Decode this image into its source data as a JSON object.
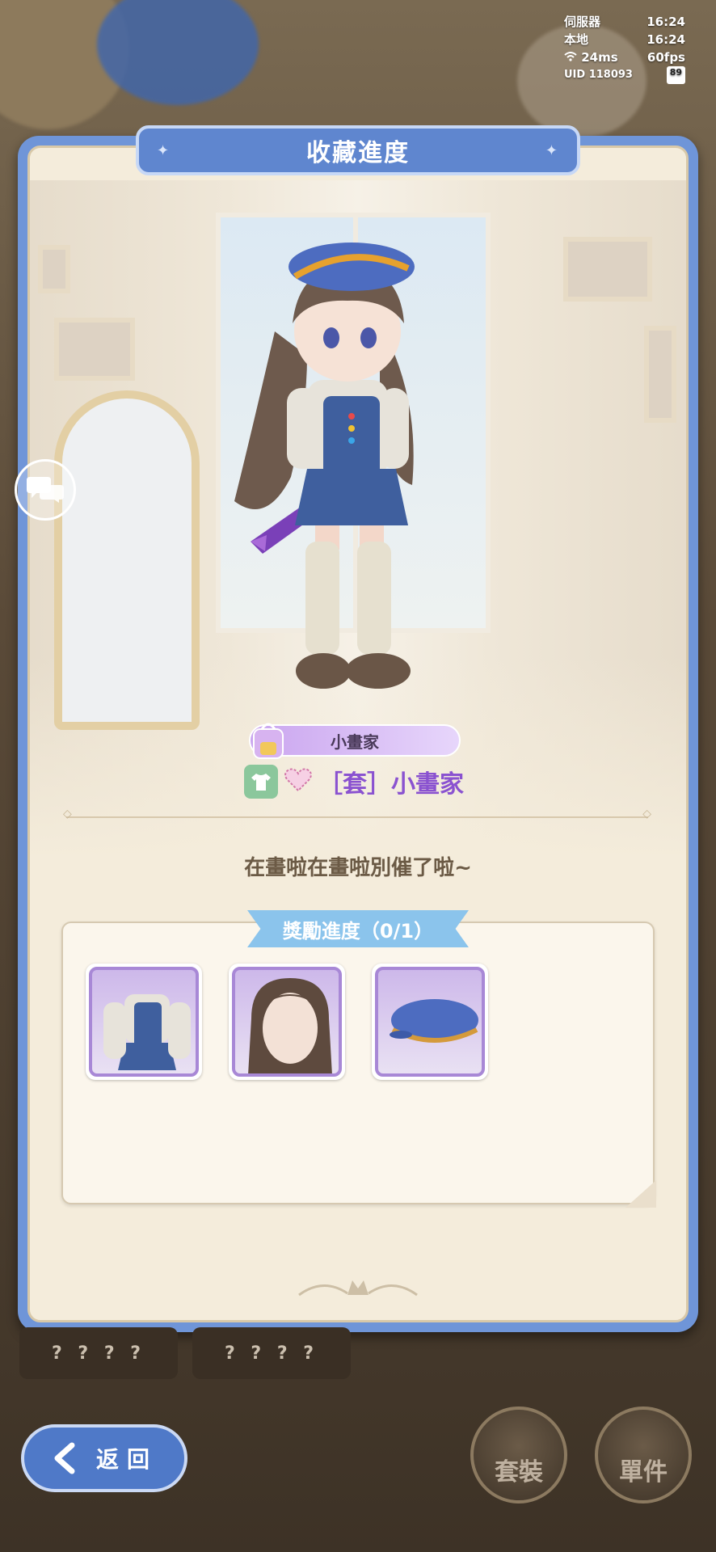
{
  "status_overlay": {
    "server_label": "伺服器",
    "server_time": "16:24",
    "local_label": "本地",
    "local_time": "16:24",
    "ping": "24ms",
    "fps": "60fps",
    "uid": "UID 118093",
    "battery": "89"
  },
  "panel": {
    "title": "收藏進度",
    "item_name": "小畫家",
    "set_name": "［套］小畫家",
    "quote": "在畫啦在畫啦別催了啦~",
    "reward_tab": "獎勵進度（0/1）"
  },
  "reward_items": [
    {
      "name": "outfit"
    },
    {
      "name": "hair"
    },
    {
      "name": "beret-hat"
    }
  ],
  "hidden_cards": [
    "? ? ? ?",
    "? ? ? ?"
  ],
  "buttons": {
    "back": "返回",
    "set": "套裝",
    "single": "單件"
  },
  "colors": {
    "panel_blue": "#6f95d8",
    "set_text_purple": "#8a52d0",
    "tab_blue": "#8bc4ec"
  }
}
